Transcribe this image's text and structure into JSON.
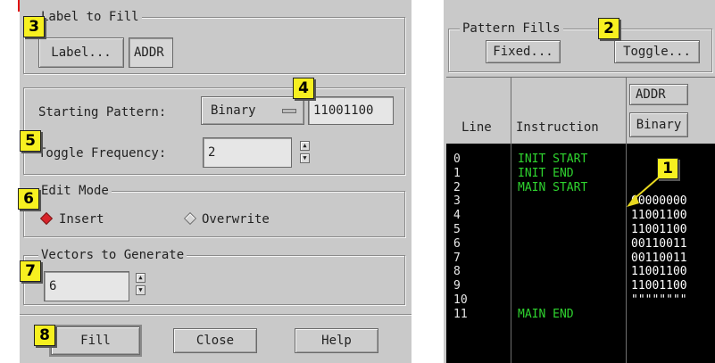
{
  "dialog": {
    "label_group": {
      "title": "Label to Fill",
      "label_button": "Label...",
      "label_value": "ADDR"
    },
    "pattern_group": {
      "starting_pattern_label": "Starting Pattern:",
      "pattern_base": "Binary",
      "pattern_value": "11001100",
      "toggle_frequency_label": "Toggle Frequency:",
      "toggle_frequency_value": "2"
    },
    "edit_mode": {
      "title": "Edit Mode",
      "insert_label": "Insert",
      "overwrite_label": "Overwrite",
      "selected": "Insert"
    },
    "vectors": {
      "title": "Vectors to Generate",
      "value": "6"
    },
    "buttons": {
      "fill": "Fill",
      "close": "Close",
      "help": "Help"
    }
  },
  "pattern_panel": {
    "title": "Pattern Fills",
    "fixed_button": "Fixed...",
    "toggle_button": "Toggle...",
    "headers": {
      "line": "Line",
      "instruction": "Instruction",
      "label": "ADDR",
      "base": "Binary"
    },
    "rows": [
      {
        "line": "0",
        "instruction": "INIT START",
        "data": ""
      },
      {
        "line": "1",
        "instruction": "INIT END",
        "data": ""
      },
      {
        "line": "2",
        "instruction": "MAIN START",
        "data": ""
      },
      {
        "line": "3",
        "instruction": "",
        "data": "00000000"
      },
      {
        "line": "4",
        "instruction": "",
        "data": "11001100"
      },
      {
        "line": "5",
        "instruction": "",
        "data": "11001100"
      },
      {
        "line": "6",
        "instruction": "",
        "data": "00110011"
      },
      {
        "line": "7",
        "instruction": "",
        "data": "00110011"
      },
      {
        "line": "8",
        "instruction": "",
        "data": "11001100"
      },
      {
        "line": "9",
        "instruction": "",
        "data": "11001100"
      },
      {
        "line": "10",
        "instruction": "",
        "data": "\"\"\"\"\"\"\"\""
      },
      {
        "line": "11",
        "instruction": "MAIN END",
        "data": ""
      }
    ]
  },
  "callouts": [
    "1",
    "2",
    "3",
    "4",
    "5",
    "6",
    "7",
    "8"
  ],
  "colors": {
    "dialog_bg": "#c9c9c9",
    "grid_bg": "#000000",
    "instruction_text": "#2fd42f",
    "callout_bg": "#f7f020",
    "radio_selected": "#d8232a"
  }
}
